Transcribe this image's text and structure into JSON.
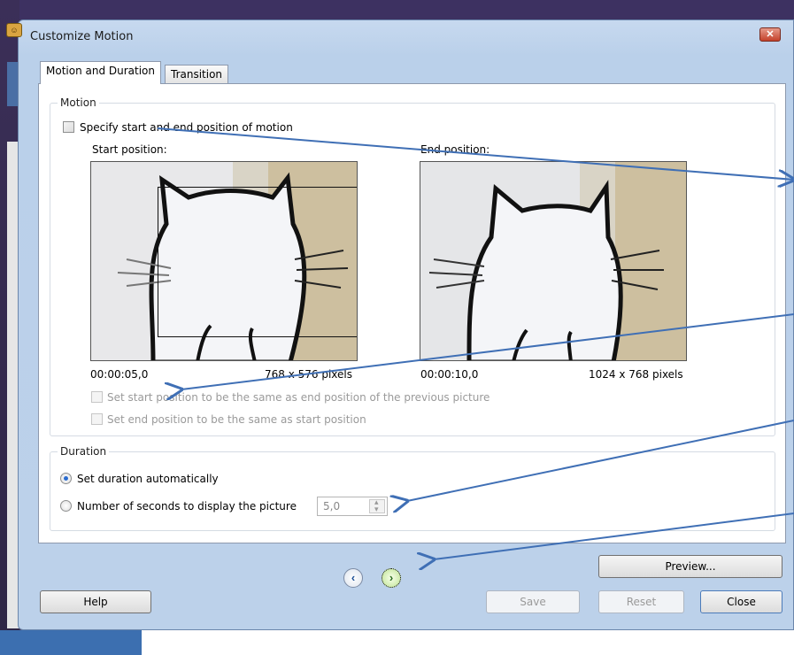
{
  "dialog": {
    "title": "Customize Motion",
    "close_glyph": "✕",
    "app_icon_glyph": "☺"
  },
  "tabs": [
    {
      "label": "Motion and Duration",
      "active": true
    },
    {
      "label": "Transition",
      "active": false
    }
  ],
  "motion": {
    "group_title": "Motion",
    "specify_checkbox": {
      "label": "Specify start and end position of motion",
      "checked": false
    },
    "start": {
      "heading": "Start position:",
      "time": "00:00:05,0",
      "size": "768 x 576 pixels"
    },
    "end": {
      "heading": "End position:",
      "time": "00:00:10,0",
      "size": "1024 x 768 pixels"
    },
    "option_start_same": {
      "label": "Set start position to be the same as end position of the previous picture",
      "enabled": false
    },
    "option_end_same": {
      "label": "Set end position to be the same as start position",
      "enabled": false
    }
  },
  "duration": {
    "group_title": "Duration",
    "auto": {
      "label": "Set duration automatically",
      "checked": true
    },
    "manual": {
      "label": "Number of seconds to display the picture",
      "checked": false,
      "value": "5,0"
    }
  },
  "nav": {
    "prev_glyph": "‹",
    "next_glyph": "›"
  },
  "buttons": {
    "preview": "Preview...",
    "help": "Help",
    "save": "Save",
    "reset": "Reset",
    "close": "Close"
  },
  "colors": {
    "annotation_arrow": "#3f6fb5",
    "dialog_frame": "#bcd1ea",
    "radio_selected": "#2b6ccf"
  }
}
